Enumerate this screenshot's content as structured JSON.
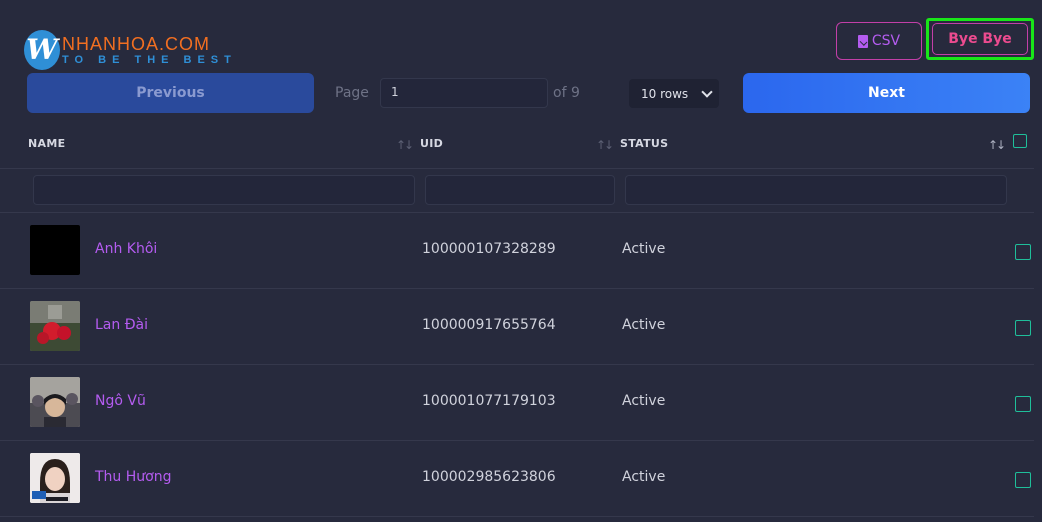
{
  "logo": {
    "mark": "W",
    "name": "NHANHOA.COM",
    "tagline": "TO BE THE BEST"
  },
  "toolbar": {
    "csv_label": "CSV",
    "bye_label": "Bye Bye"
  },
  "pagination": {
    "prev_label": "Previous",
    "page_label": "Page",
    "page_value": "1",
    "of_label": "of 9",
    "rows_label": "10 rows",
    "next_label": "Next"
  },
  "table": {
    "headers": {
      "name": "NAME",
      "uid": "UID",
      "status": "STATUS"
    },
    "rows": [
      {
        "name": "Anh Khôi",
        "uid": "100000107328289",
        "status": "Active"
      },
      {
        "name": "Lan Đài",
        "uid": "100000917655764",
        "status": "Active"
      },
      {
        "name": "Ngô Vũ",
        "uid": "100001077179103",
        "status": "Active"
      },
      {
        "name": "Thu Hương",
        "uid": "100002985623806",
        "status": "Active"
      }
    ]
  },
  "colors": {
    "background": "#272a3d",
    "accent_purple": "#b45cf0",
    "accent_blue": "#3b82f6",
    "checkbox": "#1fbf9a",
    "highlight": "#19e619"
  }
}
